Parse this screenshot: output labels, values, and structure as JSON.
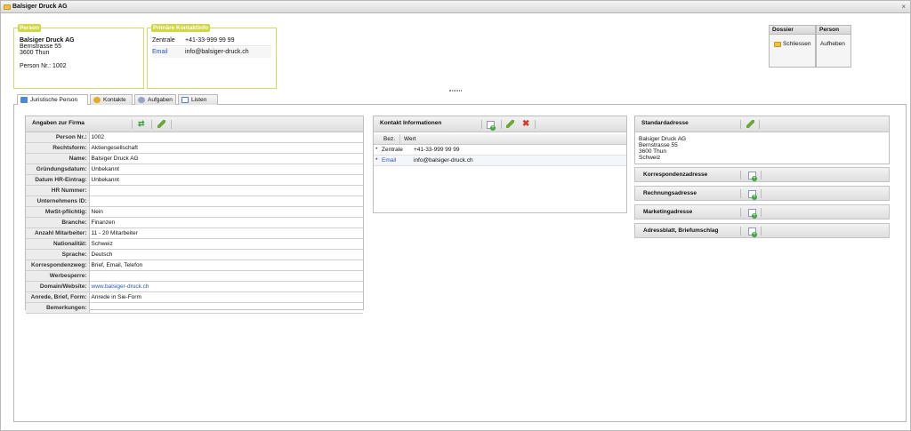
{
  "window": {
    "title": "Balsiger Druck AG",
    "close_label": "×"
  },
  "person_box": {
    "legend": "Person",
    "name": "Balsiger Druck AG",
    "street": "Bernstrasse 55",
    "city": "3600 Thun",
    "person_nr": "Person Nr.: 1002"
  },
  "contact_box": {
    "legend": "Primäre Kontaktinfo",
    "rows": [
      {
        "key": "Zentrale",
        "value": "+41-33-999 99 99"
      },
      {
        "key": "Email",
        "value": "info@balsiger-druck.ch"
      }
    ]
  },
  "toolbar": {
    "dossier": {
      "header": "Dossier",
      "button": "Schliessen"
    },
    "person": {
      "header": "Person",
      "button": "Aufheben"
    }
  },
  "tabs": [
    {
      "label": "Juristische Person",
      "active": true
    },
    {
      "label": "Kontakte",
      "active": false
    },
    {
      "label": "Aufgaben",
      "active": false
    },
    {
      "label": "Listen",
      "active": false
    }
  ],
  "firma": {
    "title": "Angaben zur Firma",
    "fields": [
      {
        "label": "Person Nr.:",
        "value": "1002"
      },
      {
        "label": "Rechtsform:",
        "value": "Aktiengesellschaft"
      },
      {
        "label": "Name:",
        "value": "Balsiger Druck AG"
      },
      {
        "label": "Gründungsdatum:",
        "value": "Unbekannt"
      },
      {
        "label": "Datum HR-Eintrag:",
        "value": "Unbekannt"
      },
      {
        "label": "HR Nummer:",
        "value": ""
      },
      {
        "label": "Unternehmens ID:",
        "value": ""
      },
      {
        "label": "MwSt-pflichtig:",
        "value": "Nein"
      },
      {
        "label": "Branche:",
        "value": "Finanzen"
      },
      {
        "label": "Anzahl Mitarbeiter:",
        "value": "11 - 20 Mitarbeiter"
      },
      {
        "label": "Nationalität:",
        "value": "Schweiz"
      },
      {
        "label": "Sprache:",
        "value": "Deutsch"
      },
      {
        "label": "Korrespondenzweg:",
        "value": "Brief, Email, Telefon"
      },
      {
        "label": "Werbesperre:",
        "value": ""
      },
      {
        "label": "Domain/Website:",
        "value": "www.balsiger-druck.ch"
      },
      {
        "label": "Anrede, Brief, Form:",
        "value": "Anrede in Sie-Form"
      },
      {
        "label": "Bemerkungen:",
        "value": ""
      }
    ]
  },
  "kontakt": {
    "title": "Kontakt Informationen",
    "col_bez": "Bez.",
    "col_wert": "Wert",
    "rows": [
      {
        "bez": "Zentrale",
        "wert": "+41-33-999 99 99"
      },
      {
        "bez": "Email",
        "wert": "info@balsiger-druck.ch"
      }
    ]
  },
  "adressen": {
    "standard_title": "Standardadresse",
    "standard_lines": [
      "Balsiger Druck AG",
      "Bernstrasse 55",
      "3600 Thun",
      "Schweiz"
    ],
    "others": [
      "Korrespondenzadresse",
      "Rechnungsadresse",
      "Marketingadresse",
      "Adressblatt, Briefumschlag"
    ]
  },
  "colors": {
    "accent_legend": "#cfd742",
    "link": "#2a56b8"
  }
}
